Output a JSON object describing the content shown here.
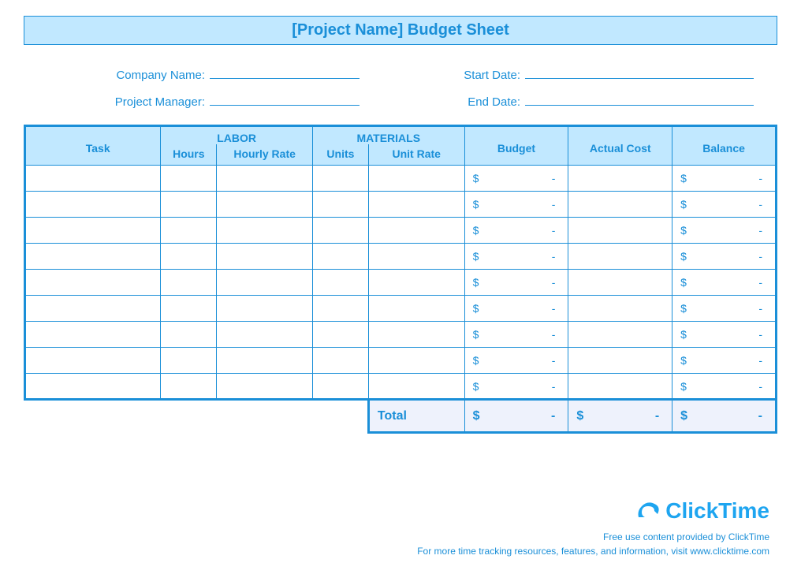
{
  "title": "[Project Name] Budget Sheet",
  "meta": {
    "company_label": "Company Name:",
    "start_label": "Start Date:",
    "manager_label": "Project Manager:",
    "end_label": "End Date:"
  },
  "columns": {
    "task": "Task",
    "labor_group": "LABOR",
    "hours": "Hours",
    "hourly_rate": "Hourly Rate",
    "materials_group": "MATERIALS",
    "units": "Units",
    "unit_rate": "Unit Rate",
    "budget": "Budget",
    "actual_cost": "Actual Cost",
    "balance": "Balance"
  },
  "rows": [
    {
      "budget_sym": "$",
      "budget_val": "-",
      "balance_sym": "$",
      "balance_val": "-"
    },
    {
      "budget_sym": "$",
      "budget_val": "-",
      "balance_sym": "$",
      "balance_val": "-"
    },
    {
      "budget_sym": "$",
      "budget_val": "-",
      "balance_sym": "$",
      "balance_val": "-"
    },
    {
      "budget_sym": "$",
      "budget_val": "-",
      "balance_sym": "$",
      "balance_val": "-"
    },
    {
      "budget_sym": "$",
      "budget_val": "-",
      "balance_sym": "$",
      "balance_val": "-"
    },
    {
      "budget_sym": "$",
      "budget_val": "-",
      "balance_sym": "$",
      "balance_val": "-"
    },
    {
      "budget_sym": "$",
      "budget_val": "-",
      "balance_sym": "$",
      "balance_val": "-"
    },
    {
      "budget_sym": "$",
      "budget_val": "-",
      "balance_sym": "$",
      "balance_val": "-"
    },
    {
      "budget_sym": "$",
      "budget_val": "-",
      "balance_sym": "$",
      "balance_val": "-"
    }
  ],
  "total": {
    "label": "Total",
    "budget_sym": "$",
    "budget_val": "-",
    "actual_sym": "$",
    "actual_val": "-",
    "balance_sym": "$",
    "balance_val": "-"
  },
  "brand": "ClickTime",
  "credit1": "Free use content provided by ClickTime",
  "credit2": "For more time tracking resources, features, and information, visit www.clicktime.com"
}
